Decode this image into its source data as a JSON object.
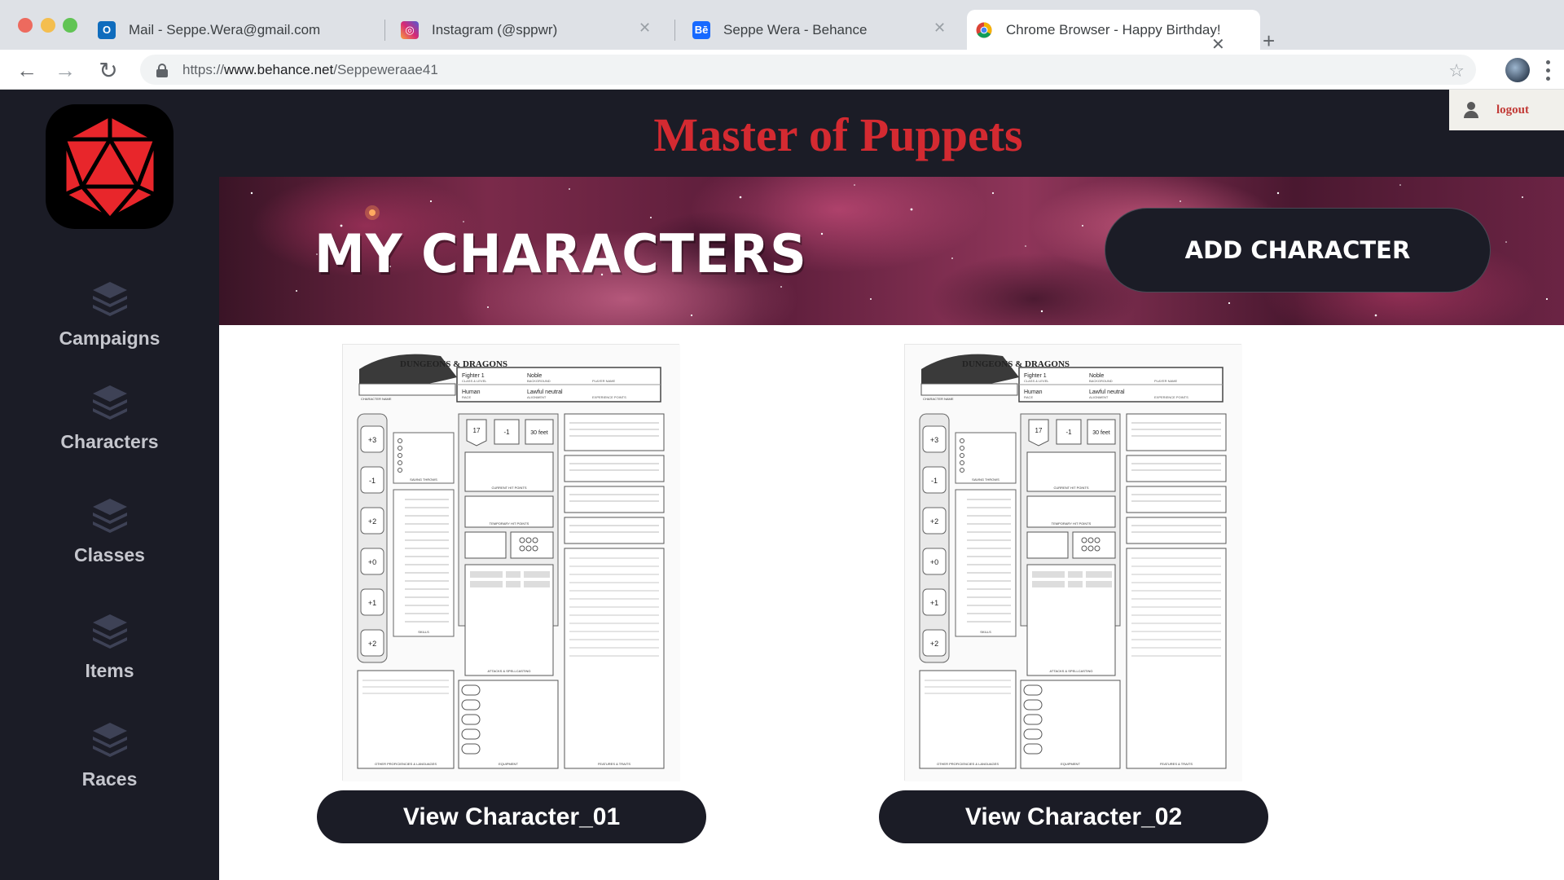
{
  "browser": {
    "tabs": [
      {
        "title": "Mail - Seppe.Wera@gmail.com",
        "icon": "outlook-icon",
        "active": false
      },
      {
        "title": "Instagram (@sppwr)",
        "icon": "instagram-icon",
        "active": false
      },
      {
        "title": "Seppe Wera - Behance",
        "icon": "behance-icon",
        "active": false
      },
      {
        "title": "Chrome Browser - Happy Birthday!",
        "icon": "chrome-icon",
        "active": true
      }
    ],
    "url_prefix": "https://",
    "url_domain": "www.behance.net",
    "url_path": "/Seppeweraae41"
  },
  "app": {
    "title": "Master of Puppets",
    "logout_label": "logout",
    "sidebar": {
      "items": [
        {
          "label": "Campaigns",
          "icon": "layers-icon"
        },
        {
          "label": "Characters",
          "icon": "layers-icon"
        },
        {
          "label": "Classes",
          "icon": "layers-icon"
        },
        {
          "label": "Items",
          "icon": "layers-icon"
        },
        {
          "label": "Races",
          "icon": "layers-icon"
        }
      ]
    },
    "banner": {
      "title": "MY CHARACTERS",
      "add_button": "ADD CHARACTER"
    },
    "characters": [
      {
        "button": "View Character_01"
      },
      {
        "button": "View Character_02"
      }
    ],
    "sheet": {
      "brand": "DUNGEONS & DRAGONS",
      "class_level": "Fighter 1",
      "background": "Noble",
      "race": "Human",
      "alignment": "Lawful neutral",
      "ability_mods": [
        "+3",
        "-1",
        "+2",
        "+0",
        "+1",
        "+2"
      ],
      "armor_class": "17",
      "initiative": "-1",
      "speed": "30 feet",
      "labels": {
        "class_level": "CLASS & LEVEL",
        "background": "BACKGROUND",
        "player_name": "PLAYER NAME",
        "character_name": "CHARACTER NAME",
        "race": "RACE",
        "alignment": "ALIGNMENT",
        "experience": "EXPERIENCE POINTS",
        "saving_throws": "SAVING THROWS",
        "skills": "SKILLS",
        "current_hp": "CURRENT HIT POINTS",
        "temp_hp": "TEMPORARY HIT POINTS",
        "attacks": "ATTACKS & SPELLCASTING",
        "equipment": "EQUIPMENT",
        "features": "FEATURES & TRAITS",
        "proficiencies": "OTHER PROFICIENCIES & LANGUAGES"
      }
    }
  },
  "colors": {
    "app_bg": "#1b1c26",
    "title_red": "#d42a31",
    "logo_red": "#e8262b"
  }
}
